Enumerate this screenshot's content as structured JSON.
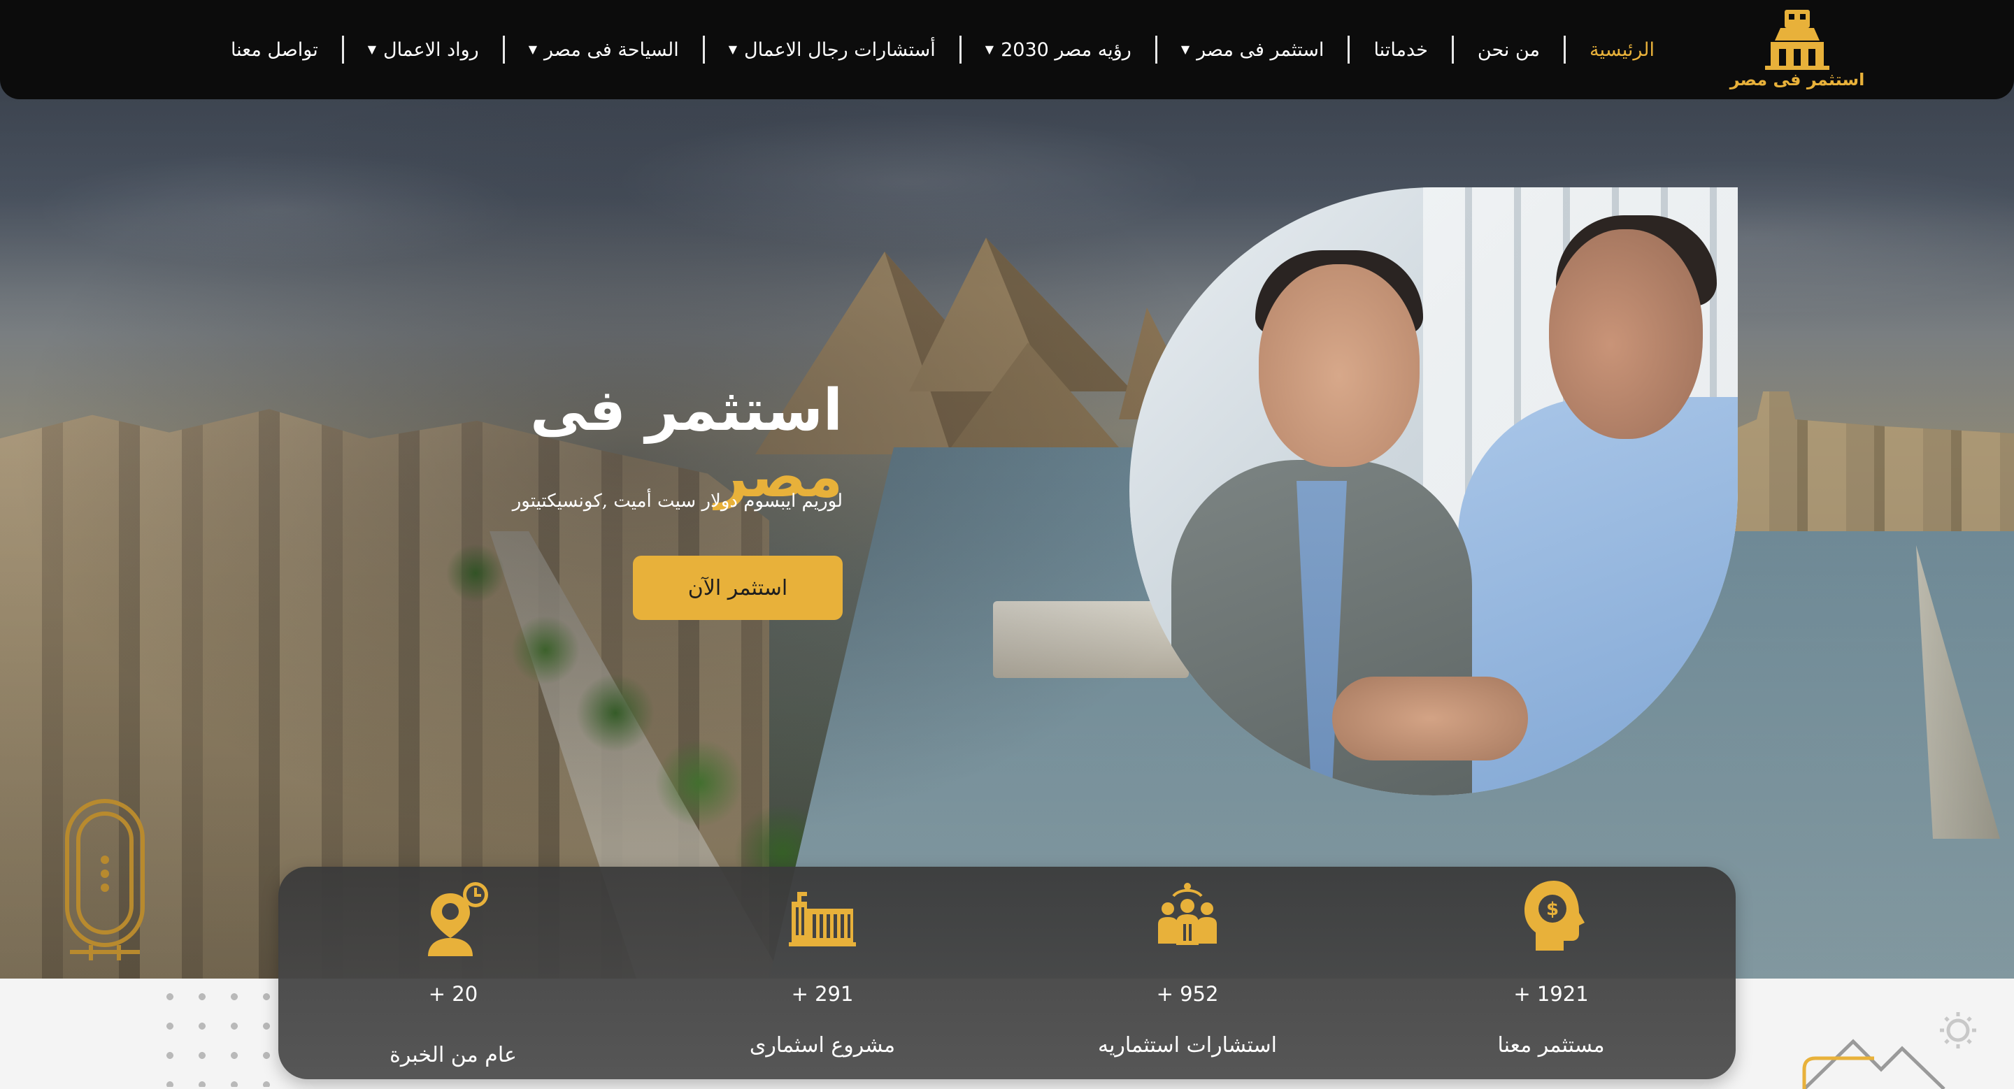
{
  "brand": {
    "logo_text": "استثمر فى مصر",
    "accent_color": "#e8b13a",
    "navbar_color": "#0c0c0c"
  },
  "nav": {
    "items": [
      {
        "label": "الرئيسية",
        "active": true,
        "dropdown": false
      },
      {
        "label": "من نحن",
        "active": false,
        "dropdown": false
      },
      {
        "label": "خدماتنا",
        "active": false,
        "dropdown": false
      },
      {
        "label": "استثمر فى مصر",
        "active": false,
        "dropdown": true
      },
      {
        "label": "رؤيه مصر 2030",
        "active": false,
        "dropdown": true
      },
      {
        "label": "أستشارات رجال الاعمال",
        "active": false,
        "dropdown": true
      },
      {
        "label": "السياحة فى مصر",
        "active": false,
        "dropdown": true
      },
      {
        "label": "رواد الاعمال",
        "active": false,
        "dropdown": true
      },
      {
        "label": "تواصل معنا",
        "active": false,
        "dropdown": false
      }
    ],
    "caret_icon": "caret-down-icon"
  },
  "hero": {
    "title_main": "استثمر فى",
    "title_accent": "مصر",
    "subtitle": "لوريم ايبسوم دولار سيت أميت ,كونسيكتيتور",
    "cta_label": "استثمر الآن"
  },
  "stats": [
    {
      "icon": "investor-head-dollar-icon",
      "value": "+ 1921",
      "label": "مستثمر معنا"
    },
    {
      "icon": "team-consulting-icon",
      "value": "+ 952",
      "label": "استشارات استثماريه"
    },
    {
      "icon": "building-project-icon",
      "value": "+ 291",
      "label": "مشروع اسثمارى"
    },
    {
      "icon": "experience-clock-person-icon",
      "value": "+ 20",
      "label": "عام من الخبرة"
    }
  ]
}
